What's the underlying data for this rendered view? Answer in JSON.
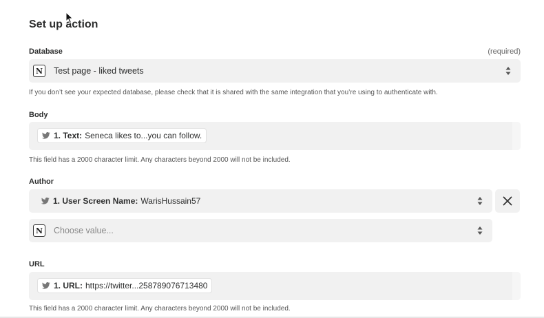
{
  "page": {
    "title": "Set up action"
  },
  "database": {
    "label": "Database",
    "required": "(required)",
    "value": "Test page - liked tweets",
    "help": "If you don’t see your expected database, please check that it is shared with the same integration that you’re using to authenticate with."
  },
  "body": {
    "label": "Body",
    "pill_key": "1. Text:",
    "pill_value": "Seneca likes to...you can follow.",
    "help": "This field has a 2000 character limit. Any characters beyond 2000 will not be included."
  },
  "author": {
    "label": "Author",
    "pill_key": "1. User Screen Name:",
    "pill_value": "WarisHussain57",
    "second_placeholder": "Choose value..."
  },
  "url": {
    "label": "URL",
    "pill_key": "1. URL:",
    "pill_value": "https://twitter...258789076713480",
    "help": "This field has a 2000 character limit. Any characters beyond 2000 will not be included."
  },
  "icons": {
    "notion": "notion-icon",
    "twitter": "twitter-bird-icon",
    "select": "chevron-up-down-icon",
    "remove": "close-icon",
    "cursor": "mouse-pointer-icon"
  }
}
